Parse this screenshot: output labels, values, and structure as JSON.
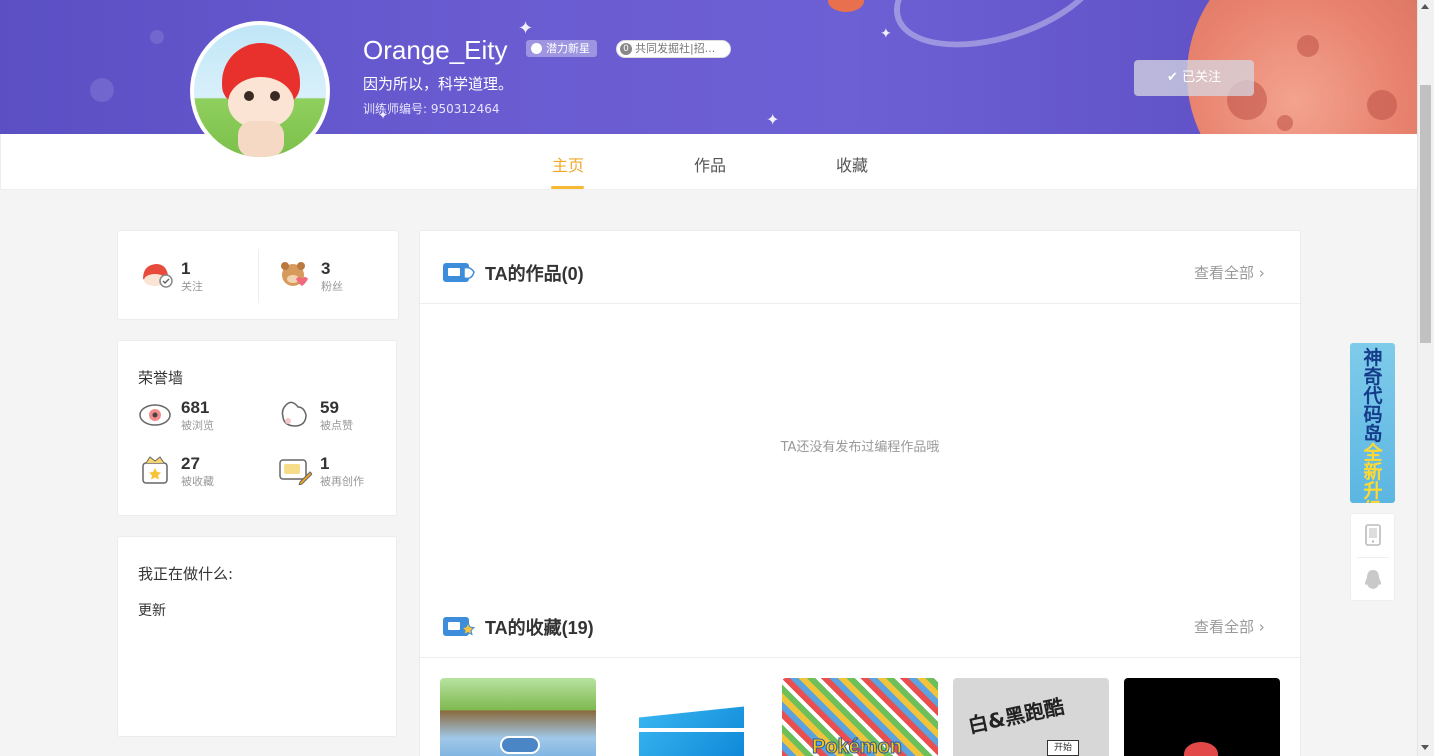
{
  "profile": {
    "name": "Orange_Eity",
    "badge_star": "潜力新星",
    "badge_club_count": "0",
    "badge_club_text": "共同发掘社|招...",
    "bio": "因为所以，科学道理。",
    "trainer_id": "训练师编号: 950312464",
    "follow_label": "已关注"
  },
  "tabs": [
    {
      "label": "主页",
      "active": true
    },
    {
      "label": "作品",
      "active": false
    },
    {
      "label": "收藏",
      "active": false
    }
  ],
  "social": {
    "following_count": "1",
    "following_label": "关注",
    "fans_count": "3",
    "fans_label": "粉丝"
  },
  "honor": {
    "title": "荣誉墙",
    "views_count": "681",
    "views_label": "被浏览",
    "likes_count": "59",
    "likes_label": "被点赞",
    "favorites_count": "27",
    "favorites_label": "被收藏",
    "remix_count": "1",
    "remix_label": "被再创作"
  },
  "doing": {
    "title": "我正在做什么:",
    "text": "更新"
  },
  "works": {
    "title": "TA的作品(0)",
    "view_all": "查看全部",
    "empty": "TA还没有发布过编程作品哦"
  },
  "collections": {
    "title": "TA的收藏(19)",
    "view_all": "查看全部",
    "items": [
      {
        "caption": ""
      },
      {
        "caption": ""
      },
      {
        "caption": "Pokémon"
      },
      {
        "caption": "白&黑跑酷"
      },
      {
        "caption": ""
      }
    ]
  },
  "promo": {
    "line1": "神奇代码岛",
    "line2": "全新升级"
  },
  "colors": {
    "accent": "#f2a82a",
    "banner": "#6a5bd1"
  }
}
